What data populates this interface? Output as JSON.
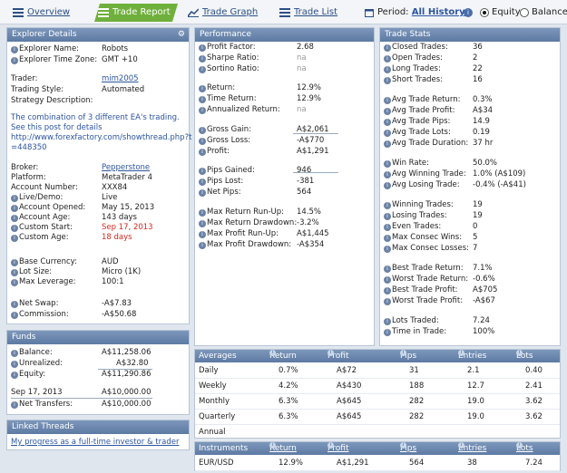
{
  "tabs": [
    {
      "label": "Overview",
      "icon": "list-icon"
    },
    {
      "label": "Trade Report",
      "icon": "report-icon"
    },
    {
      "label": "Trade Graph",
      "icon": "graph-icon"
    },
    {
      "label": "Trade List",
      "icon": "list-icon"
    }
  ],
  "period": {
    "label": "Period:",
    "value": "All History"
  },
  "modes": {
    "equity": "Equity",
    "balance": "Balance",
    "selected": "equity"
  },
  "explorer": {
    "title": "Explorer Details",
    "name_label": "Explorer Name:",
    "name": "Robots",
    "tz_label": "Explorer Time Zone:",
    "tz": "GMT +10",
    "trader_label": "Trader:",
    "trader": "mim2005",
    "style_label": "Trading Style:",
    "style": "Automated",
    "desc_label": "Strategy Description:",
    "desc": "The combination of 3 different EA's trading. See this post for details",
    "desc_url": "http://www.forexfactory.com/showthread.php?t=448350",
    "broker_label": "Broker:",
    "broker": "Pepperstone",
    "platform_label": "Platform:",
    "platform": "MetaTrader 4",
    "account_label": "Account Number:",
    "account": "XXX84",
    "live_label": "Live/Demo:",
    "live": "Live",
    "opened_label": "Account Opened:",
    "opened": "May 15, 2013",
    "age_label": "Account Age:",
    "age": "143 days",
    "cstart_label": "Custom Start:",
    "cstart": "Sep 17, 2013",
    "cage_label": "Custom Age:",
    "cage": "18 days",
    "currency_label": "Base Currency:",
    "currency": "AUD",
    "lot_label": "Lot Size:",
    "lot": "Micro (1K)",
    "leverage_label": "Max Leverage:",
    "leverage": "100:1",
    "swap_label": "Net Swap:",
    "swap": "-A$7.83",
    "commission_label": "Commission:",
    "commission": "-A$50.68"
  },
  "funds": {
    "title": "Funds",
    "balance_label": "Balance:",
    "balance": "A$11,258.06",
    "unrealized_label": "Unrealized:",
    "unrealized": "A$32.80",
    "equity_label": "Equity:",
    "equity": "A$11,290.86",
    "date_label": "Sep 17, 2013",
    "date_value": "A$10,000.00",
    "transfers_label": "Net Transfers:",
    "transfers": "A$10,000.00"
  },
  "linked": {
    "title": "Linked Threads",
    "thread": "My progress as a full-time investor & trader"
  },
  "performance": {
    "title": "Performance",
    "rows": [
      {
        "label": "Profit Factor:",
        "value": "2.68",
        "info": true
      },
      {
        "label": "Sharpe Ratio:",
        "value": "na",
        "info": true,
        "muted": true
      },
      {
        "label": "Sortino Ratio:",
        "value": "na",
        "info": true,
        "muted": true
      },
      {
        "label": "Return:",
        "value": "12.9%",
        "info": true
      },
      {
        "label": "Time Return:",
        "value": "12.9%",
        "info": true
      },
      {
        "label": "Annualized Return:",
        "value": "na",
        "info": true,
        "muted": true
      },
      {
        "label": "Gross Gain:",
        "value": "A$2,061",
        "info": true
      },
      {
        "label": "Gross Loss:",
        "value": "-A$770",
        "info": true
      },
      {
        "label": "Profit:",
        "value": "A$1,291",
        "info": true
      },
      {
        "label": "Pips Gained:",
        "value": "946",
        "info": true
      },
      {
        "label": "Pips Lost:",
        "value": "-381",
        "info": true
      },
      {
        "label": "Net Pips:",
        "value": "564",
        "info": true
      },
      {
        "label": "Max Return Run-Up:",
        "value": "14.5%",
        "info": true
      },
      {
        "label": "Max Return Drawdown:",
        "value": "-3.2%",
        "info": true
      },
      {
        "label": "Max Profit Run-Up:",
        "value": "A$1,445",
        "info": true
      },
      {
        "label": "Max Profit Drawdown:",
        "value": "-A$354",
        "info": true
      }
    ]
  },
  "stats": {
    "title": "Trade Stats",
    "rows": [
      {
        "label": "Closed Trades:",
        "value": "36"
      },
      {
        "label": "Open Trades:",
        "value": "2"
      },
      {
        "label": "Long Trades:",
        "value": "22"
      },
      {
        "label": "Short Trades:",
        "value": "16"
      },
      {
        "label": "Avg Trade Return:",
        "value": "0.3%"
      },
      {
        "label": "Avg Trade Profit:",
        "value": "A$34"
      },
      {
        "label": "Avg Trade Pips:",
        "value": "14.9"
      },
      {
        "label": "Avg Trade Lots:",
        "value": "0.19"
      },
      {
        "label": "Avg Trade Duration:",
        "value": "37 hr"
      },
      {
        "label": "Win Rate:",
        "value": "50.0%"
      },
      {
        "label": "Avg Winning Trade:",
        "value": "1.0% (A$109)"
      },
      {
        "label": "Avg Losing Trade:",
        "value": "-0.4% (-A$41)"
      },
      {
        "label": "Winning Trades:",
        "value": "19"
      },
      {
        "label": "Losing Trades:",
        "value": "19"
      },
      {
        "label": "Even Trades:",
        "value": "0"
      },
      {
        "label": "Max Consec Wins:",
        "value": "5"
      },
      {
        "label": "Max Consec Losses:",
        "value": "7"
      },
      {
        "label": "Best Trade Return:",
        "value": "7.1%"
      },
      {
        "label": "Worst Trade Return:",
        "value": "-0.6%"
      },
      {
        "label": "Best Trade Profit:",
        "value": "A$705"
      },
      {
        "label": "Worst Trade Profit:",
        "value": "-A$67"
      },
      {
        "label": "Lots Traded:",
        "value": "7.24"
      },
      {
        "label": "Time in Trade:",
        "value": "100%"
      }
    ]
  },
  "averages": {
    "headers": [
      "Averages",
      "Return",
      "Profit",
      "Pips",
      "Entries",
      "Lots"
    ],
    "rows": [
      [
        "Daily",
        "0.7%",
        "A$72",
        "31",
        "2.1",
        "0.40"
      ],
      [
        "Weekly",
        "4.2%",
        "A$430",
        "188",
        "12.7",
        "2.41"
      ],
      [
        "Monthly",
        "6.3%",
        "A$645",
        "282",
        "19.0",
        "3.62"
      ],
      [
        "Quarterly",
        "6.3%",
        "A$645",
        "282",
        "19.0",
        "3.62"
      ],
      [
        "Annual",
        "",
        "",
        "",
        "",
        ""
      ]
    ]
  },
  "instruments": {
    "headers": [
      "Instruments",
      "Return",
      "Profit",
      "Pips",
      "Entries",
      "Lots"
    ],
    "rows": [
      [
        "EUR/USD",
        "12.9%",
        "A$1,291",
        "564",
        "38",
        "7.24"
      ]
    ]
  },
  "colors": {
    "accent": "#6fb03c",
    "header": "#5d7aa3",
    "negative": "#d8261c",
    "link": "#2c55a0"
  }
}
